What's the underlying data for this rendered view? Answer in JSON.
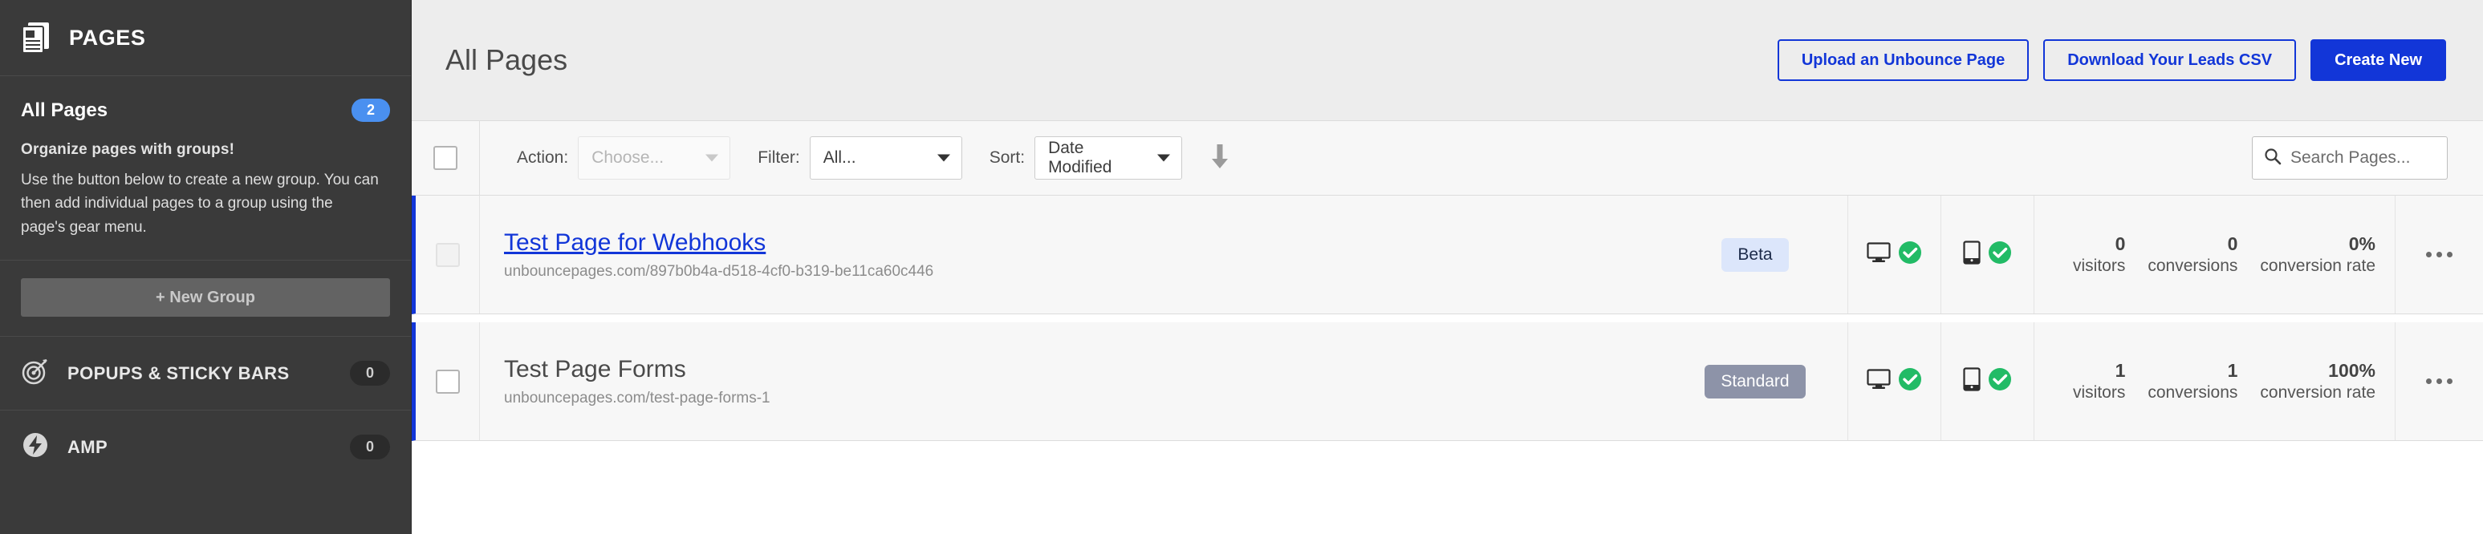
{
  "colors": {
    "brand_blue": "#1236d8",
    "sidebar_bg": "#3a3a3a",
    "badge_blue": "#4a90f0",
    "status_green": "#22bb66",
    "pill_beta_bg": "#dce6fb",
    "pill_standard_bg": "#8d93a8"
  },
  "sidebar": {
    "header": {
      "title": "PAGES",
      "icon": "pages-document-icon"
    },
    "all_pages": {
      "label": "All Pages",
      "count": "2"
    },
    "promo": {
      "title": "Organize pages with groups!",
      "body": "Use the button below to create a new group. You can then add individual pages to a group using the page's gear menu."
    },
    "new_group_button": "+ New Group",
    "items": [
      {
        "label": "POPUPS & STICKY BARS",
        "count": "0",
        "icon": "target-icon"
      },
      {
        "label": "AMP",
        "count": "0",
        "icon": "lightning-bolt-icon"
      }
    ]
  },
  "header": {
    "title": "All Pages",
    "buttons": {
      "upload": "Upload an Unbounce Page",
      "download": "Download Your Leads CSV",
      "create": "Create New"
    }
  },
  "toolbar": {
    "action_label": "Action:",
    "action_value": "Choose...",
    "filter_label": "Filter:",
    "filter_value": "All...",
    "sort_label": "Sort:",
    "sort_value": "Date Modified",
    "sort_direction": "descending",
    "search_placeholder": "Search Pages...",
    "search_value": ""
  },
  "stat_labels": {
    "visitors": "visitors",
    "conversions": "conversions",
    "conversion_rate": "conversion rate"
  },
  "rows": [
    {
      "title": "Test Page for Webhooks",
      "title_is_link": true,
      "url": "unbouncepages.com/897b0b4a-d518-4cf0-b319-be11ca60c446",
      "badge": "Beta",
      "badge_style": "beta",
      "desktop_status": "published",
      "mobile_status": "published",
      "visitors": "0",
      "conversions": "0",
      "conversion_rate": "0%"
    },
    {
      "title": "Test Page Forms",
      "title_is_link": false,
      "url": "unbouncepages.com/test-page-forms-1",
      "badge": "Standard",
      "badge_style": "standard",
      "desktop_status": "published",
      "mobile_status": "published",
      "visitors": "1",
      "conversions": "1",
      "conversion_rate": "100%"
    }
  ]
}
